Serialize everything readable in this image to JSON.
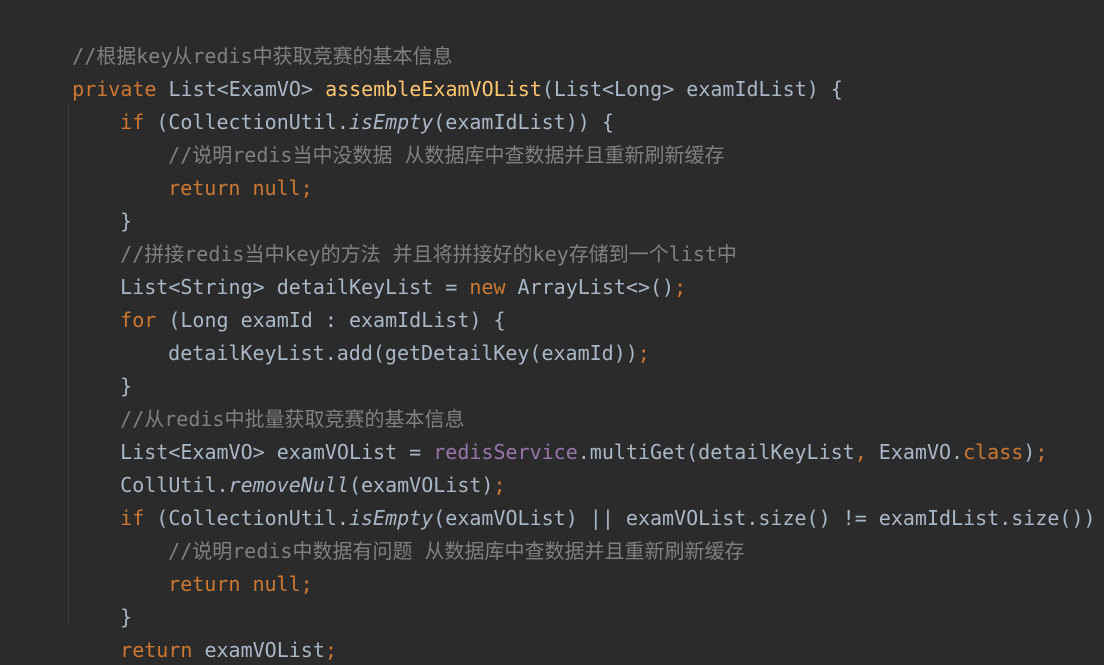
{
  "code": {
    "l1": {
      "comment": "//根据key从redis中获取竞赛的基本信息"
    },
    "l2": {
      "kw": "private",
      "t1": "List<ExamVO>",
      "fn": "assembleExamVOList",
      "t2": "(List<Long> examIdList) {"
    },
    "l3": {
      "kw": "if",
      "t1": "(CollectionUtil.",
      "m": "isEmpty",
      "t2": "(examIdList)) {"
    },
    "l4": {
      "comment": "//说明redis当中没数据 从数据库中查数据并且重新刷新缓存"
    },
    "l5": {
      "kw": "return null",
      "semi": ";"
    },
    "l6": {
      "t": "}"
    },
    "l7": {
      "comment": "//拼接redis当中key的方法 并且将拼接好的key存储到一个list中"
    },
    "l8": {
      "t1": "List<String> detailKeyList = ",
      "kw": "new",
      "t2": " ArrayList<>()",
      "semi": ";"
    },
    "l9": {
      "kw": "for",
      "t": " (Long examId : examIdList) {"
    },
    "l10": {
      "t": "detailKeyList.add(getDetailKey(examId))",
      "semi": ";"
    },
    "l11": {
      "t": "}"
    },
    "l12": {
      "comment": "//从redis中批量获取竞赛的基本信息"
    },
    "l13": {
      "t1": "List<ExamVO> examVOList = ",
      "fld": "redisService",
      "t2": ".multiGet(detailKeyList",
      "comma": ",",
      "t3": " ExamVO.",
      "kw": "class",
      "t4": ")",
      "semi": ";"
    },
    "l14": {
      "t1": "CollUtil.",
      "m": "removeNull",
      "t2": "(examVOList)",
      "semi": ";"
    },
    "l15": {
      "kw": "if",
      "t1": " (CollectionUtil.",
      "m": "isEmpty",
      "t2": "(examVOList) || examVOList.size() != examIdList.size()) {"
    },
    "l16": {
      "comment": "//说明redis中数据有问题 从数据库中查数据并且重新刷新缓存"
    },
    "l17": {
      "kw": "return null",
      "semi": ";"
    },
    "l18": {
      "t": "}"
    },
    "l19": {
      "kw": "return",
      "t": " examVOList",
      "semi": ";"
    },
    "l20": {
      "t": "}"
    }
  },
  "colors": {
    "background": "#2b2b2b",
    "text": "#a9b7c6",
    "keyword": "#cc7832",
    "function": "#ffc66d",
    "comment": "#808080",
    "field": "#9876aa"
  }
}
